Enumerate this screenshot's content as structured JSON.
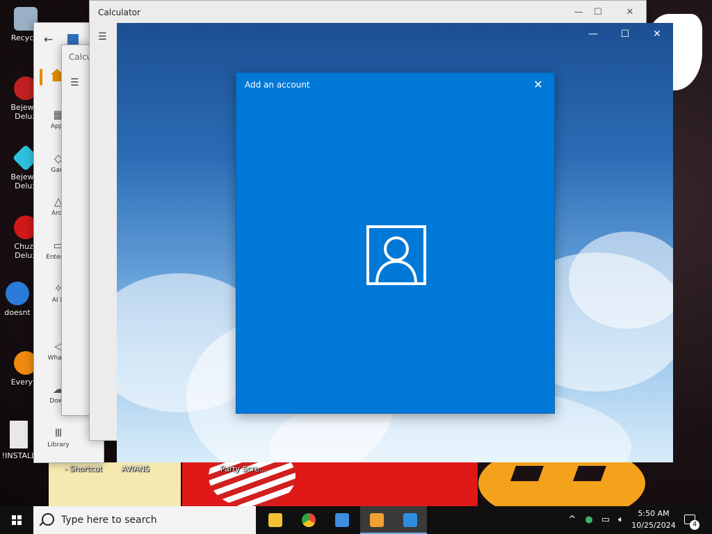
{
  "desktop": {
    "icons": [
      {
        "label": "Recycle",
        "color": "#9ab0c4"
      },
      {
        "label": "Bejewel\nDelux",
        "color": "#c02020"
      },
      {
        "label": "Bejewel\nDelux",
        "color": "#2fc0e0"
      },
      {
        "label": "Chuzz\nDelux",
        "color": "#d01818"
      },
      {
        "label": "doesnt",
        "color": "#2a7cd8"
      },
      {
        "label": "Everyth",
        "color": "#f08a10"
      },
      {
        "label": "!INSTALL",
        "color": "#e8e8e8"
      }
    ],
    "bottom_labels": [
      "- Shortcut",
      "AVIANS",
      "Party Scre..."
    ]
  },
  "store_window": {
    "nav": [
      "Apps",
      "Gam",
      "Arca",
      "Entertai",
      "AI H",
      "What's",
      "Down",
      "Library"
    ]
  },
  "calc_back": {
    "title": "Calcu"
  },
  "calc_window": {
    "title": "Calculator"
  },
  "dialog": {
    "title": "Add an account",
    "close_icon": "close-icon",
    "icon": "user-account-icon",
    "bg_color": "#0078d7"
  },
  "taskbar": {
    "search_placeholder": "Type here to search",
    "apps": [
      {
        "name": "file-explorer",
        "color": "#f1c232"
      },
      {
        "name": "chrome",
        "color": "#e84b3c"
      },
      {
        "name": "microsoft-store",
        "color": "#3c8de0"
      },
      {
        "name": "calculator",
        "color": "#f0a030"
      },
      {
        "name": "mail",
        "color": "#2f8de0"
      }
    ],
    "time": "5:50 AM",
    "date": "10/25/2024",
    "notification_count": "4"
  }
}
